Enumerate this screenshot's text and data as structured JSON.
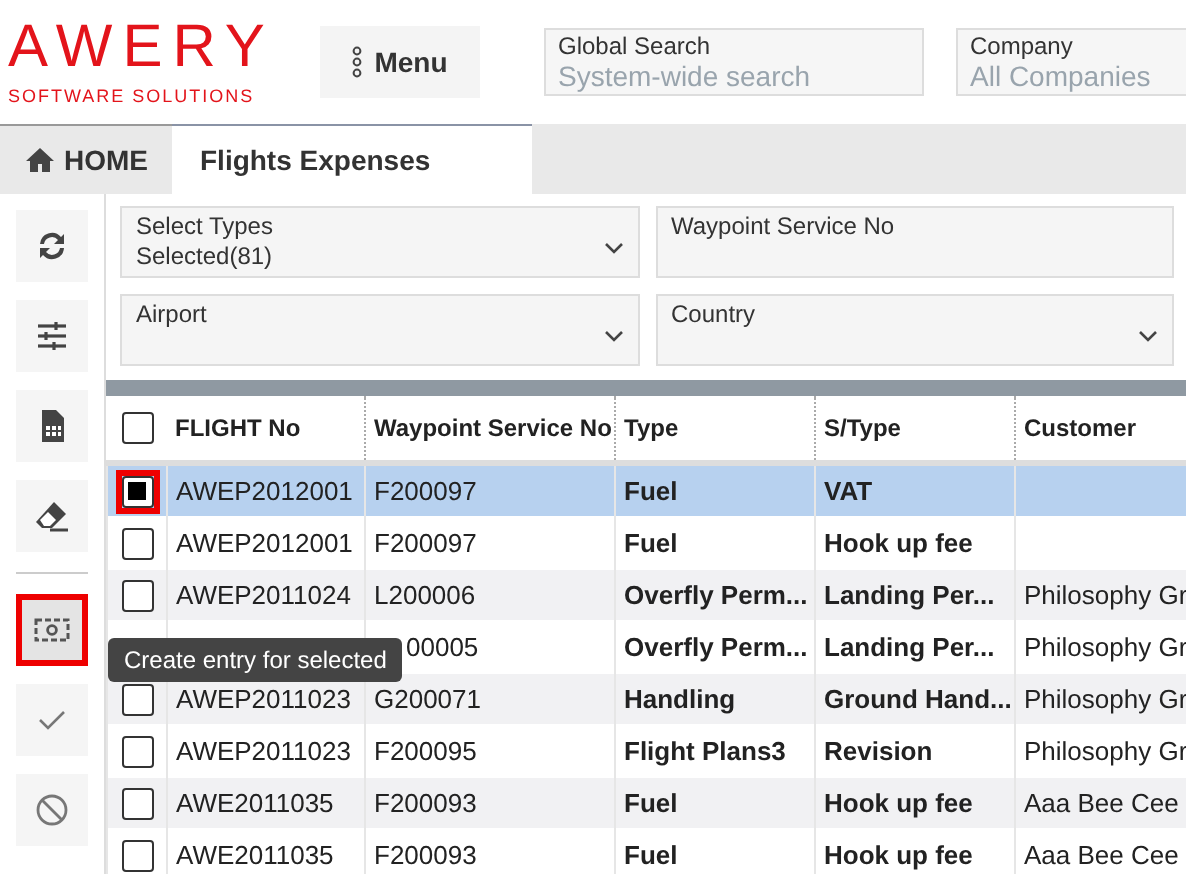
{
  "logo": {
    "name": "AWERY",
    "tagline": "SOFTWARE SOLUTIONS"
  },
  "menu_button": {
    "label": "Menu"
  },
  "global_search": {
    "label": "Global Search",
    "placeholder": "System-wide search"
  },
  "company": {
    "label": "Company",
    "placeholder": "All Companies"
  },
  "tabs": [
    {
      "label": "HOME",
      "kind": "home",
      "selected": false
    },
    {
      "label": "Flights Expenses",
      "kind": "plain",
      "selected": true
    }
  ],
  "toolbar": [
    {
      "kind": "refresh",
      "highlighted": false
    },
    {
      "kind": "sliders",
      "highlighted": false
    },
    {
      "kind": "sheet",
      "highlighted": false
    },
    {
      "kind": "eraser",
      "highlighted": false
    },
    {
      "kind": "divider"
    },
    {
      "kind": "money",
      "highlighted": true
    },
    {
      "kind": "check",
      "highlighted": false
    },
    {
      "kind": "block",
      "highlighted": false
    }
  ],
  "tooltip": "Create entry for selected",
  "filters": [
    {
      "label": "Select Types",
      "value": "Selected(81)",
      "dropdown": true
    },
    {
      "label": "Waypoint Service No",
      "dropdown": false
    },
    {
      "label": "Airport",
      "dropdown": true
    },
    {
      "label": "Country",
      "dropdown": true
    }
  ],
  "table": {
    "select_all_checked": false,
    "columns": [
      "FLIGHT No",
      "Waypoint Service No",
      "Type",
      "S/Type",
      "Customer"
    ],
    "rows": [
      {
        "checked": true,
        "selected": true,
        "highlighted": true,
        "flight": "AWEP2012001",
        "waypoint": "F200097",
        "type": "Fuel",
        "subtype": "VAT"
      },
      {
        "checked": false,
        "selected": false,
        "highlighted": false,
        "flight": "AWEP2012001",
        "waypoint": "F200097",
        "type": "Fuel",
        "subtype": "Hook up fee"
      },
      {
        "checked": false,
        "selected": false,
        "highlighted": false,
        "flight": "AWEP2011024",
        "waypoint": "L200006",
        "type": "Overfly Perm...",
        "subtype": "Landing Per...",
        "customer": "Philosophy Gr"
      },
      {
        "selected": false,
        "waypoint": "00005",
        "type": "Overfly Perm...",
        "subtype": "Landing Per...",
        "customer": "Philosophy Gr"
      },
      {
        "checked": false,
        "selected": false,
        "highlighted": false,
        "flight": "AWEP2011023",
        "waypoint": "G200071",
        "type": "Handling",
        "subtype": "Ground Hand...",
        "customer": "Philosophy Gr"
      },
      {
        "checked": false,
        "selected": false,
        "highlighted": false,
        "flight": "AWEP2011023",
        "waypoint": "F200095",
        "type": "Flight Plans3",
        "subtype": "Revision",
        "customer": "Philosophy Gr"
      },
      {
        "checked": false,
        "selected": false,
        "highlighted": false,
        "flight": "AWE2011035",
        "waypoint": "F200093",
        "type": "Fuel",
        "subtype": "Hook up fee",
        "customer": "Aaa Bee Cee"
      },
      {
        "checked": false,
        "selected": false,
        "highlighted": false,
        "flight": "AWE2011035",
        "waypoint": "F200093",
        "type": "Fuel",
        "subtype": "Hook up fee",
        "customer": "Aaa Bee Cee"
      }
    ]
  }
}
